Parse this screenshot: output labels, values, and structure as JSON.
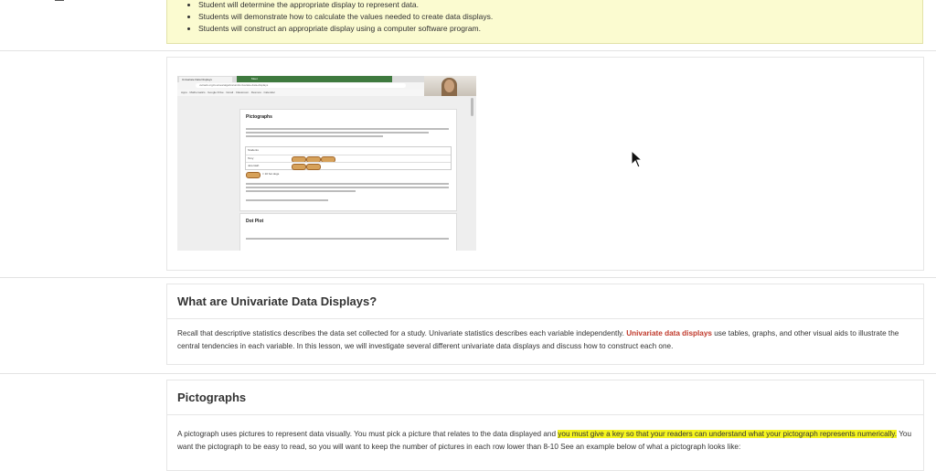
{
  "objectives": {
    "items": [
      "Student will determine the appropriate display to represent data.",
      "Students will demonstrate how to calculate the values needed to create data displays.",
      "Students will construct an appropriate display using a computer software program."
    ]
  },
  "video": {
    "browser_tab": "Univariate Data Displays",
    "meet_tab": "Meet",
    "address": "uvtrack.org/courses/algebra/unit/univariate-data-displays",
    "bookmarks": "Apps  ·  Mathematics  ·  Google Drive  ·  Gmail  ·  Classroom  ·  Desmos  ·  Calendar",
    "pictographs_heading": "Pictographs",
    "dot_plot_heading": "Dot Plot",
    "table_rows": [
      "Students",
      "Tony",
      "Jeremiah"
    ],
    "key_label": "= 10 hot dogs"
  },
  "univariate": {
    "title": "What are Univariate Data Displays?",
    "p1": "Recall that descriptive statistics describes the data set collected for a study.  Univariate statistics describes each variable independently. ",
    "highlight": "Univariate data displays",
    "p2": " use tables, graphs, and other visual aids to illustrate the central tendencies in each variable.  In this lesson, we will investigate several different univariate data displays and discuss how to construct each one."
  },
  "pictographs": {
    "title": "Pictographs",
    "p1": "A pictograph uses pictures to represent data visually.  You must pick a picture that relates to the data displayed and ",
    "highlight": "you must give a key so that your readers can understand what your pictograph represents numerically.",
    "p2": " You want the pictograph to be easy to read, so you will want to keep the number of pictures in each row lower than 8-10 See an example below of what a pictograph looks like:"
  },
  "colors": {
    "objectives_bg": "#fbfbd0",
    "highlight": "#f5f520",
    "keyword_red": "#c0392b"
  }
}
